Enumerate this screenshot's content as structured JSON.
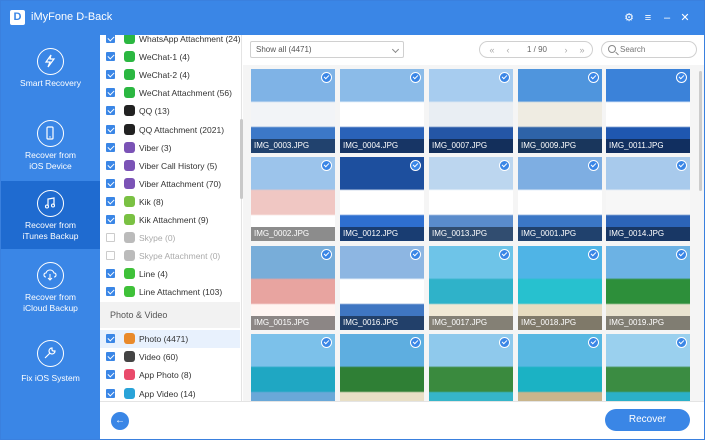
{
  "app": {
    "title": "iMyFone D-Back",
    "logo_letter": "D"
  },
  "window_controls": {
    "settings": "⚙",
    "menu": "≡",
    "minimize": "–",
    "close": "✕"
  },
  "sidebar": {
    "items": [
      {
        "label": "Smart Recovery",
        "active": false
      },
      {
        "label": "Recover from\niOS Device",
        "active": false
      },
      {
        "label": "Recover from\niTunes Backup",
        "active": true
      },
      {
        "label": "Recover from\niCloud Backup",
        "active": false
      },
      {
        "label": "Fix iOS System",
        "active": false
      }
    ]
  },
  "categories": {
    "items": [
      {
        "label": "WhatsApp Attachment (24)",
        "checked": true,
        "icon": "whatsapp-icon",
        "color": "#2bb741"
      },
      {
        "label": "WeChat-1 (4)",
        "checked": true,
        "icon": "wechat-icon",
        "color": "#2bb741"
      },
      {
        "label": "WeChat-2 (4)",
        "checked": true,
        "icon": "wechat-icon",
        "color": "#2bb741"
      },
      {
        "label": "WeChat Attachment (56)",
        "checked": true,
        "icon": "wechat-icon",
        "color": "#2bb741"
      },
      {
        "label": "QQ (13)",
        "checked": true,
        "icon": "qq-icon",
        "color": "#222222"
      },
      {
        "label": "QQ Attachment (2021)",
        "checked": true,
        "icon": "qq-icon",
        "color": "#222222"
      },
      {
        "label": "Viber (3)",
        "checked": true,
        "icon": "viber-icon",
        "color": "#7b53b6"
      },
      {
        "label": "Viber Call History (5)",
        "checked": true,
        "icon": "viber-icon",
        "color": "#7b53b6"
      },
      {
        "label": "Viber Attachment (70)",
        "checked": true,
        "icon": "viber-icon",
        "color": "#7b53b6"
      },
      {
        "label": "Kik (8)",
        "checked": true,
        "icon": "kik-icon",
        "color": "#7ac143"
      },
      {
        "label": "Kik Attachment (9)",
        "checked": true,
        "icon": "kik-icon",
        "color": "#7ac143"
      },
      {
        "label": "Skype (0)",
        "checked": false,
        "disabled": true,
        "icon": "skype-icon",
        "color": "#bbbbbb"
      },
      {
        "label": "Skype Attachment (0)",
        "checked": false,
        "disabled": true,
        "icon": "skype-icon",
        "color": "#bbbbbb"
      },
      {
        "label": "Line (4)",
        "checked": true,
        "icon": "line-icon",
        "color": "#3fc139"
      },
      {
        "label": "Line Attachment (103)",
        "checked": true,
        "icon": "line-icon",
        "color": "#3fc139"
      }
    ],
    "section_title": "Photo & Video",
    "media_items": [
      {
        "label": "Photo (4471)",
        "checked": true,
        "selected": true,
        "icon": "photo-icon",
        "color": "#e98a2b"
      },
      {
        "label": "Video (60)",
        "checked": true,
        "icon": "video-icon",
        "color": "#444444"
      },
      {
        "label": "App Photo (8)",
        "checked": true,
        "icon": "app-photo-icon",
        "color": "#e94b6b"
      },
      {
        "label": "App Video (14)",
        "checked": true,
        "icon": "app-video-icon",
        "color": "#29a3d8"
      }
    ]
  },
  "toolbar": {
    "filter": "Show all (4471)",
    "pager": "1 / 90",
    "search_placeholder": "Search"
  },
  "photos": [
    {
      "name": "IMG_0003.JPG",
      "colors": [
        "#7fb3e6",
        "#f2f4f7",
        "#3c78c8"
      ]
    },
    {
      "name": "IMG_0004.JPG",
      "colors": [
        "#8bbbe8",
        "#ffffff",
        "#2a62b8"
      ]
    },
    {
      "name": "IMG_0007.JPG",
      "colors": [
        "#a7ccef",
        "#e9eef3",
        "#2456a6"
      ]
    },
    {
      "name": "IMG_0009.JPG",
      "colors": [
        "#4f95dd",
        "#efece2",
        "#2e63a8"
      ]
    },
    {
      "name": "IMG_0011.JPG",
      "colors": [
        "#3b82d9",
        "#ffffff",
        "#1f57b0"
      ]
    },
    {
      "name": "IMG_0002.JPG",
      "colors": [
        "#9cc4eb",
        "#f0c7c3",
        "#ffffff"
      ]
    },
    {
      "name": "IMG_0012.JPG",
      "colors": [
        "#1d4f9e",
        "#ffffff",
        "#2e6fd0"
      ]
    },
    {
      "name": "IMG_0013.JPG",
      "colors": [
        "#bcd6ef",
        "#ffffff",
        "#5a8ccc"
      ]
    },
    {
      "name": "IMG_0001.JPG",
      "colors": [
        "#7eaee2",
        "#ffffff",
        "#3b77c6"
      ]
    },
    {
      "name": "IMG_0014.JPG",
      "colors": [
        "#a8caec",
        "#f7f7f7",
        "#2c64b8"
      ]
    },
    {
      "name": "IMG_0015.JPG",
      "colors": [
        "#78add9",
        "#e8a4a0",
        "#fff5f2"
      ]
    },
    {
      "name": "IMG_0016.JPG",
      "colors": [
        "#8db6e2",
        "#ffffff",
        "#3f76c2"
      ]
    },
    {
      "name": "IMG_0017.JPG",
      "colors": [
        "#6ec4e8",
        "#2fb2c9",
        "#f1e9d5"
      ]
    },
    {
      "name": "IMG_0018.JPG",
      "colors": [
        "#4fb4e6",
        "#27c1cf",
        "#e7dcc0"
      ]
    },
    {
      "name": "IMG_0019.JPG",
      "colors": [
        "#6cb2e4",
        "#2d8f3a",
        "#e9e3cf"
      ]
    },
    {
      "name": "",
      "colors": [
        "#7cc1ea",
        "#1fa7c3",
        "#6aa8d8"
      ]
    },
    {
      "name": "",
      "colors": [
        "#5eaee0",
        "#2f7f35",
        "#e8dfc6"
      ]
    },
    {
      "name": "",
      "colors": [
        "#8fc9ec",
        "#3a8a3e",
        "#36b5c9"
      ]
    },
    {
      "name": "",
      "colors": [
        "#58b8e2",
        "#1bb2c4",
        "#c9b58c"
      ]
    },
    {
      "name": "",
      "colors": [
        "#9ad0ee",
        "#3b8c42",
        "#2bb0c8"
      ]
    }
  ],
  "footer": {
    "back": "←",
    "recover_label": "Recover"
  },
  "colors": {
    "accent": "#3a86e6",
    "active_nav": "#1f6bd0"
  }
}
